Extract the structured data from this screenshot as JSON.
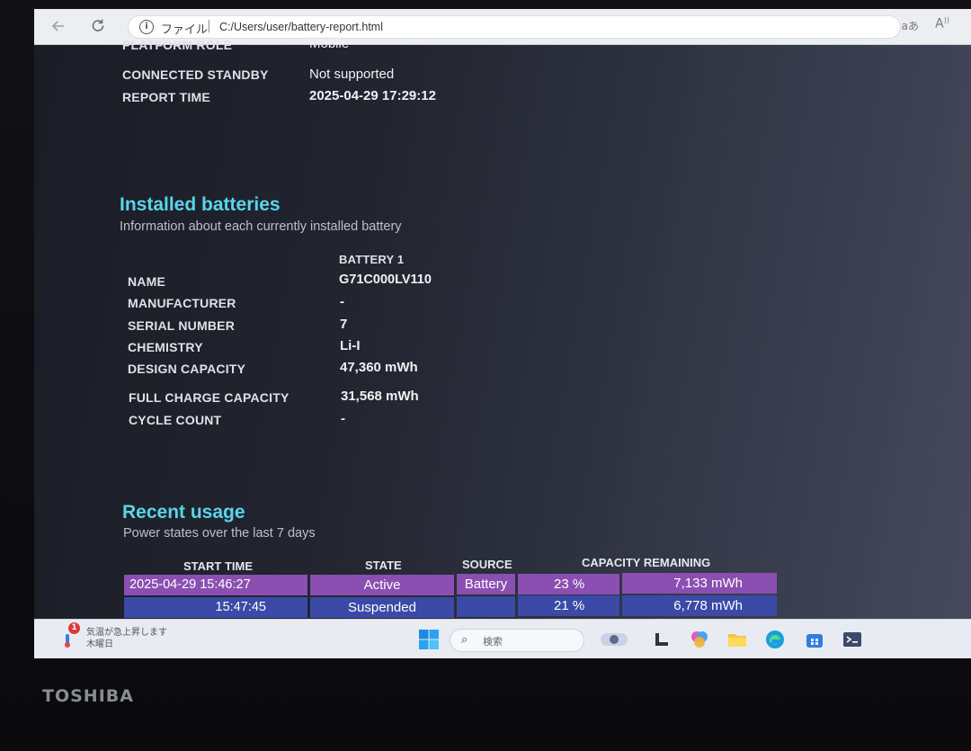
{
  "browser": {
    "address_scheme": "ファイル",
    "address_separator": "|",
    "url": "C:/Users/user/battery-report.html",
    "reader_label": "aあ",
    "read_aloud_label": "A"
  },
  "system_info": {
    "cutoff_rows": [
      {
        "label": "PLATFORM ROLE",
        "value": "Mobile"
      }
    ],
    "rows": [
      {
        "label": "CONNECTED STANDBY",
        "value": "Not supported"
      },
      {
        "label": "REPORT TIME",
        "value": "2025-04-29  17:29:12"
      }
    ]
  },
  "installed_batteries": {
    "title": "Installed batteries",
    "subtitle": "Information about each currently installed battery",
    "column_header": "BATTERY 1",
    "rows": [
      {
        "label": "NAME",
        "value": "G71C000LV110"
      },
      {
        "label": "MANUFACTURER",
        "value": "-"
      },
      {
        "label": "SERIAL NUMBER",
        "value": "7"
      },
      {
        "label": "CHEMISTRY",
        "value": "Li-I"
      },
      {
        "label": "DESIGN CAPACITY",
        "value": "47,360 mWh"
      },
      {
        "label": "FULL CHARGE CAPACITY",
        "value": "31,568 mWh"
      },
      {
        "label": "CYCLE COUNT",
        "value": "-"
      }
    ]
  },
  "recent_usage": {
    "title": "Recent usage",
    "subtitle": "Power states over the last 7 days",
    "headers": {
      "start_time": "START TIME",
      "state": "STATE",
      "source": "SOURCE",
      "capacity_remaining": "CAPACITY REMAINING"
    },
    "rows": [
      {
        "start_time": "2025-04-29  15:46:27",
        "state": "Active",
        "source": "Battery",
        "percent": "23 %",
        "mwh": "7,133 mWh"
      },
      {
        "start_time": "15:47:45",
        "state": "Suspended",
        "source": "",
        "percent": "21 %",
        "mwh": "6,778 mWh"
      }
    ]
  },
  "taskbar": {
    "weather_line1": "気温が急上昇します",
    "weather_line2": "木曜日",
    "search_placeholder": "検索",
    "badge_count": "1"
  },
  "device": {
    "brand": "TOSHIBA"
  },
  "colors": {
    "section_title": "#5ad4e8",
    "usage_row_active": "#8a4fb0",
    "usage_row_suspended": "#3a4aa6"
  }
}
